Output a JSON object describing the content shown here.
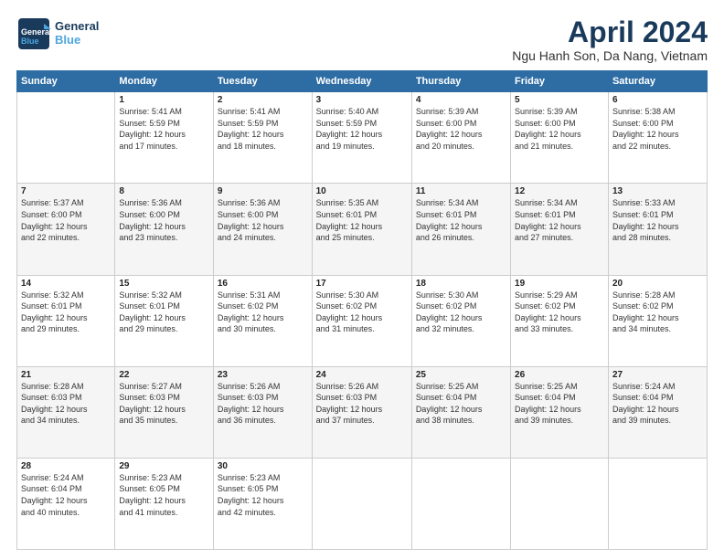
{
  "logo": {
    "line1": "General",
    "line2": "Blue"
  },
  "header": {
    "title": "April 2024",
    "subtitle": "Ngu Hanh Son, Da Nang, Vietnam"
  },
  "days_of_week": [
    "Sunday",
    "Monday",
    "Tuesday",
    "Wednesday",
    "Thursday",
    "Friday",
    "Saturday"
  ],
  "weeks": [
    [
      {
        "num": "",
        "info": ""
      },
      {
        "num": "1",
        "info": "Sunrise: 5:41 AM\nSunset: 5:59 PM\nDaylight: 12 hours\nand 17 minutes."
      },
      {
        "num": "2",
        "info": "Sunrise: 5:41 AM\nSunset: 5:59 PM\nDaylight: 12 hours\nand 18 minutes."
      },
      {
        "num": "3",
        "info": "Sunrise: 5:40 AM\nSunset: 5:59 PM\nDaylight: 12 hours\nand 19 minutes."
      },
      {
        "num": "4",
        "info": "Sunrise: 5:39 AM\nSunset: 6:00 PM\nDaylight: 12 hours\nand 20 minutes."
      },
      {
        "num": "5",
        "info": "Sunrise: 5:39 AM\nSunset: 6:00 PM\nDaylight: 12 hours\nand 21 minutes."
      },
      {
        "num": "6",
        "info": "Sunrise: 5:38 AM\nSunset: 6:00 PM\nDaylight: 12 hours\nand 22 minutes."
      }
    ],
    [
      {
        "num": "7",
        "info": "Sunrise: 5:37 AM\nSunset: 6:00 PM\nDaylight: 12 hours\nand 22 minutes."
      },
      {
        "num": "8",
        "info": "Sunrise: 5:36 AM\nSunset: 6:00 PM\nDaylight: 12 hours\nand 23 minutes."
      },
      {
        "num": "9",
        "info": "Sunrise: 5:36 AM\nSunset: 6:00 PM\nDaylight: 12 hours\nand 24 minutes."
      },
      {
        "num": "10",
        "info": "Sunrise: 5:35 AM\nSunset: 6:01 PM\nDaylight: 12 hours\nand 25 minutes."
      },
      {
        "num": "11",
        "info": "Sunrise: 5:34 AM\nSunset: 6:01 PM\nDaylight: 12 hours\nand 26 minutes."
      },
      {
        "num": "12",
        "info": "Sunrise: 5:34 AM\nSunset: 6:01 PM\nDaylight: 12 hours\nand 27 minutes."
      },
      {
        "num": "13",
        "info": "Sunrise: 5:33 AM\nSunset: 6:01 PM\nDaylight: 12 hours\nand 28 minutes."
      }
    ],
    [
      {
        "num": "14",
        "info": "Sunrise: 5:32 AM\nSunset: 6:01 PM\nDaylight: 12 hours\nand 29 minutes."
      },
      {
        "num": "15",
        "info": "Sunrise: 5:32 AM\nSunset: 6:01 PM\nDaylight: 12 hours\nand 29 minutes."
      },
      {
        "num": "16",
        "info": "Sunrise: 5:31 AM\nSunset: 6:02 PM\nDaylight: 12 hours\nand 30 minutes."
      },
      {
        "num": "17",
        "info": "Sunrise: 5:30 AM\nSunset: 6:02 PM\nDaylight: 12 hours\nand 31 minutes."
      },
      {
        "num": "18",
        "info": "Sunrise: 5:30 AM\nSunset: 6:02 PM\nDaylight: 12 hours\nand 32 minutes."
      },
      {
        "num": "19",
        "info": "Sunrise: 5:29 AM\nSunset: 6:02 PM\nDaylight: 12 hours\nand 33 minutes."
      },
      {
        "num": "20",
        "info": "Sunrise: 5:28 AM\nSunset: 6:02 PM\nDaylight: 12 hours\nand 34 minutes."
      }
    ],
    [
      {
        "num": "21",
        "info": "Sunrise: 5:28 AM\nSunset: 6:03 PM\nDaylight: 12 hours\nand 34 minutes."
      },
      {
        "num": "22",
        "info": "Sunrise: 5:27 AM\nSunset: 6:03 PM\nDaylight: 12 hours\nand 35 minutes."
      },
      {
        "num": "23",
        "info": "Sunrise: 5:26 AM\nSunset: 6:03 PM\nDaylight: 12 hours\nand 36 minutes."
      },
      {
        "num": "24",
        "info": "Sunrise: 5:26 AM\nSunset: 6:03 PM\nDaylight: 12 hours\nand 37 minutes."
      },
      {
        "num": "25",
        "info": "Sunrise: 5:25 AM\nSunset: 6:04 PM\nDaylight: 12 hours\nand 38 minutes."
      },
      {
        "num": "26",
        "info": "Sunrise: 5:25 AM\nSunset: 6:04 PM\nDaylight: 12 hours\nand 39 minutes."
      },
      {
        "num": "27",
        "info": "Sunrise: 5:24 AM\nSunset: 6:04 PM\nDaylight: 12 hours\nand 39 minutes."
      }
    ],
    [
      {
        "num": "28",
        "info": "Sunrise: 5:24 AM\nSunset: 6:04 PM\nDaylight: 12 hours\nand 40 minutes."
      },
      {
        "num": "29",
        "info": "Sunrise: 5:23 AM\nSunset: 6:05 PM\nDaylight: 12 hours\nand 41 minutes."
      },
      {
        "num": "30",
        "info": "Sunrise: 5:23 AM\nSunset: 6:05 PM\nDaylight: 12 hours\nand 42 minutes."
      },
      {
        "num": "",
        "info": ""
      },
      {
        "num": "",
        "info": ""
      },
      {
        "num": "",
        "info": ""
      },
      {
        "num": "",
        "info": ""
      }
    ]
  ]
}
